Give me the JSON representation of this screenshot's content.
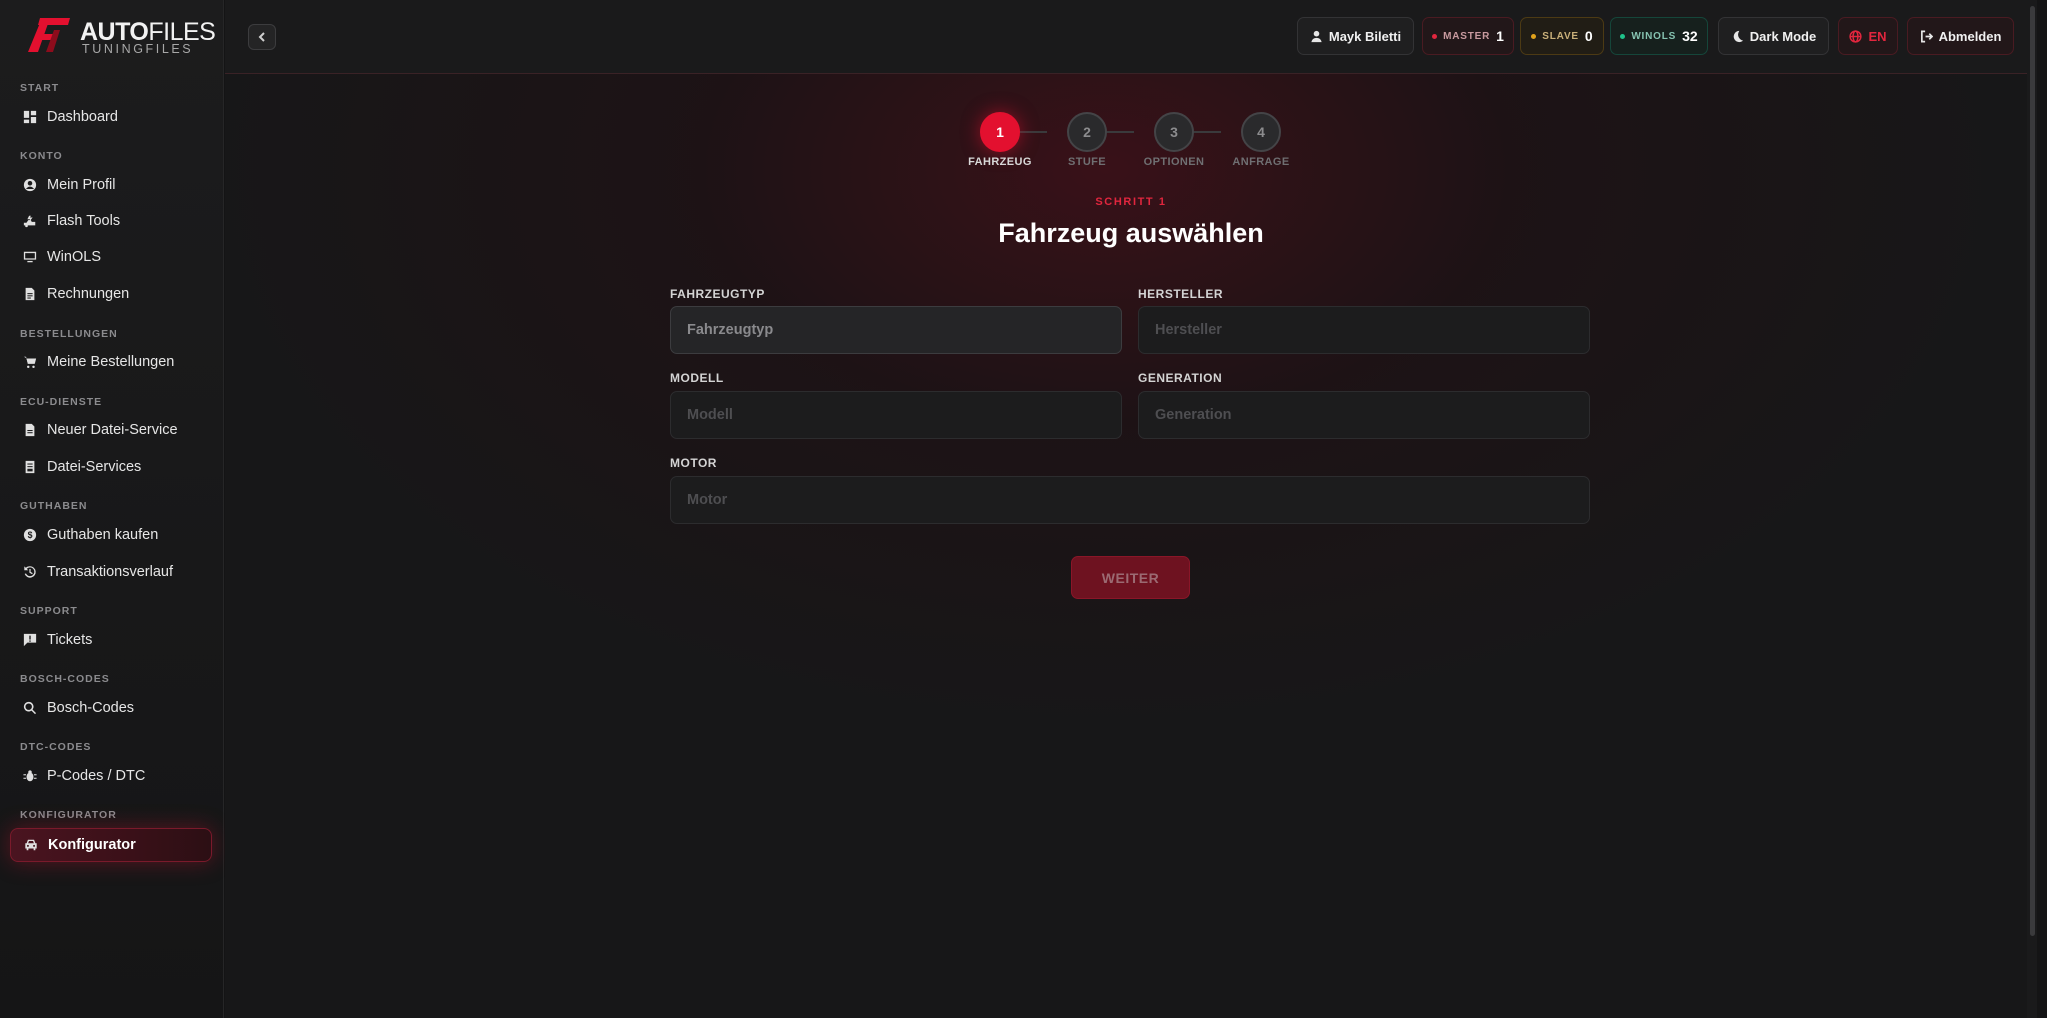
{
  "brand": {
    "name_bold": "AUTO",
    "name_thin": "FILES",
    "tagline": "TUNINGFILES",
    "accent": "#e3102f"
  },
  "sidebar": {
    "sections": [
      {
        "title": "START",
        "items": [
          {
            "label": "Dashboard",
            "icon": "dashboard-icon"
          }
        ]
      },
      {
        "title": "KONTO",
        "items": [
          {
            "label": "Mein Profil",
            "icon": "user-circle-icon"
          },
          {
            "label": "Flash Tools",
            "icon": "flash-tools-icon"
          },
          {
            "label": "WinOLS",
            "icon": "monitor-icon"
          },
          {
            "label": "Rechnungen",
            "icon": "document-icon"
          }
        ]
      },
      {
        "title": "BESTELLUNGEN",
        "items": [
          {
            "label": "Meine Bestellungen",
            "icon": "cart-icon"
          }
        ]
      },
      {
        "title": "ECU-DIENSTE",
        "items": [
          {
            "label": "Neuer Datei-Service",
            "icon": "file-icon"
          },
          {
            "label": "Datei-Services",
            "icon": "receipt-icon"
          }
        ]
      },
      {
        "title": "GUTHABEN",
        "items": [
          {
            "label": "Guthaben kaufen",
            "icon": "coin-icon"
          },
          {
            "label": "Transaktionsverlauf",
            "icon": "history-icon"
          }
        ]
      },
      {
        "title": "SUPPORT",
        "items": [
          {
            "label": "Tickets",
            "icon": "ticket-icon"
          }
        ]
      },
      {
        "title": "BOSCH-CODES",
        "items": [
          {
            "label": "Bosch-Codes",
            "icon": "search-icon"
          }
        ]
      },
      {
        "title": "DTC-CODES",
        "items": [
          {
            "label": "P-Codes / DTC",
            "icon": "bug-icon"
          }
        ]
      },
      {
        "title": "KONFIGURATOR",
        "items": [
          {
            "label": "Konfigurator",
            "icon": "car-icon",
            "active": true
          }
        ]
      }
    ]
  },
  "topbar": {
    "user": "Mayk Biletti",
    "master_label": "MASTER",
    "master_value": "1",
    "slave_label": "SLAVE",
    "slave_value": "0",
    "winols_label": "WINOLS",
    "winols_value": "32",
    "theme_label": "Dark Mode",
    "lang_label": "EN",
    "logout_label": "Abmelden",
    "colors": {
      "master": "#e1263e",
      "slave": "#e0a21b",
      "winols": "#1fc28a"
    }
  },
  "stepper": {
    "steps": [
      {
        "number": "1",
        "label": "FAHRZEUG",
        "active": true
      },
      {
        "number": "2",
        "label": "STUFE",
        "active": false
      },
      {
        "number": "3",
        "label": "OPTIONEN",
        "active": false
      },
      {
        "number": "4",
        "label": "ANFRAGE",
        "active": false
      }
    ],
    "kicker": "SCHRITT 1",
    "title": "Fahrzeug auswählen"
  },
  "form": {
    "vehicle_type": {
      "label": "FAHRZEUGTYP",
      "placeholder": "Fahrzeugtyp",
      "value": ""
    },
    "manufacturer": {
      "label": "HERSTELLER",
      "placeholder": "Hersteller",
      "value": ""
    },
    "model": {
      "label": "MODELL",
      "placeholder": "Modell",
      "value": ""
    },
    "generation": {
      "label": "GENERATION",
      "placeholder": "Generation",
      "value": ""
    },
    "engine": {
      "label": "MOTOR",
      "placeholder": "Motor",
      "value": ""
    },
    "next_label": "WEITER"
  }
}
